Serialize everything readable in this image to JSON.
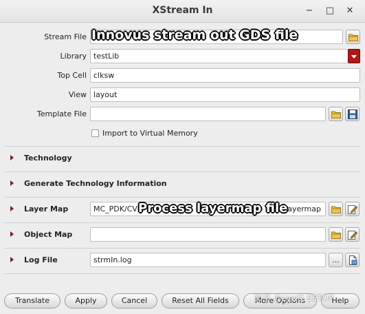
{
  "window": {
    "title": "XStream In",
    "controls": {
      "minimize": "−",
      "maximize": "□",
      "close": "✕"
    }
  },
  "form": {
    "stream_file": {
      "label": "Stream File",
      "value": ""
    },
    "library": {
      "label": "Library",
      "value": "testLib"
    },
    "top_cell": {
      "label": "Top Cell",
      "value": "clksw"
    },
    "view": {
      "label": "View",
      "value": "layout"
    },
    "template_file": {
      "label": "Template File",
      "value": ""
    },
    "import_vm": {
      "label": "Import to Virtual Memory",
      "checked": false
    }
  },
  "sections": {
    "technology": {
      "label": "Technology"
    },
    "gen_tech": {
      "label": "Generate Technology Information"
    },
    "layer_map": {
      "label": "Layer Map",
      "value": "MC_PDK/CVN",
      "value_suffix": "5.layermap"
    },
    "object_map": {
      "label": "Object Map",
      "value": ""
    },
    "log_file": {
      "label": "Log File",
      "value": "strmIn.log",
      "browse_label": "..."
    }
  },
  "annotations": {
    "stream_file_note": "Innovus stream out GDS file",
    "layer_map_note": "Process layermap file"
  },
  "buttons": {
    "translate": "Translate",
    "apply": "Apply",
    "cancel": "Cancel",
    "reset_all_fields": "Reset All Fields",
    "more_options": "More Options",
    "help": "Help"
  },
  "watermark": "知乎 @zywtt EETOP",
  "colors": {
    "accent": "#b01818",
    "section_triangle": "#9a1212",
    "window_bg": "#ededed"
  },
  "icons": {
    "folder": "folder-icon",
    "save": "save-icon",
    "edit": "edit-icon",
    "log_file": "document-icon"
  }
}
